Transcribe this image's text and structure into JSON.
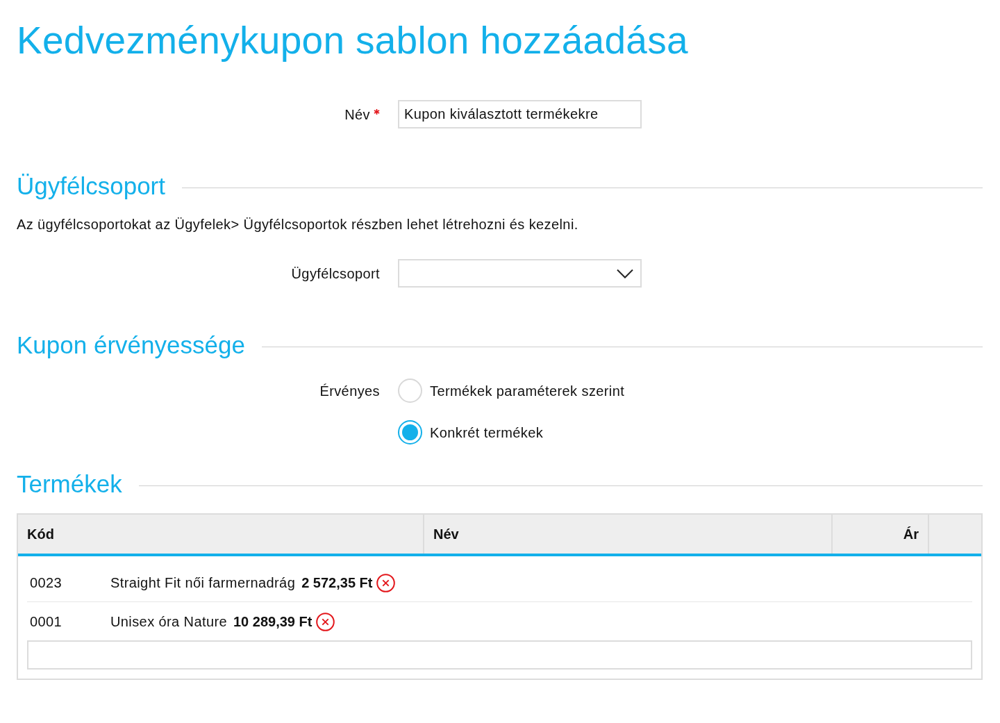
{
  "title": "Kedvezménykupon sablon hozzáadása",
  "name_field": {
    "label": "Név",
    "required": true,
    "value": "Kupon kiválasztott termékekre"
  },
  "customer_group": {
    "heading": "Ügyfélcsoport",
    "note": "Az ügyfélcsoportokat az Ügyfelek> Ügyfélcsoportok részben lehet létrehozni és kezelni.",
    "field": {
      "label": "Ügyfélcsoport"
    }
  },
  "validity": {
    "heading": "Kupon érvényessége",
    "label": "Érvényes",
    "options": [
      {
        "label": "Termékek paraméterek szerint",
        "selected": false
      },
      {
        "label": "Konkrét termékek",
        "selected": true
      }
    ]
  },
  "products": {
    "heading": "Termékek",
    "columns": [
      "Kód",
      "Név",
      "Ár"
    ],
    "rows": [
      {
        "code": "0023",
        "name": "Straight Fit női farmernadrág",
        "price": "2 572,35 Ft"
      },
      {
        "code": "0001",
        "name": "Unisex óra Nature",
        "price": "10 289,39 Ft"
      }
    ]
  }
}
